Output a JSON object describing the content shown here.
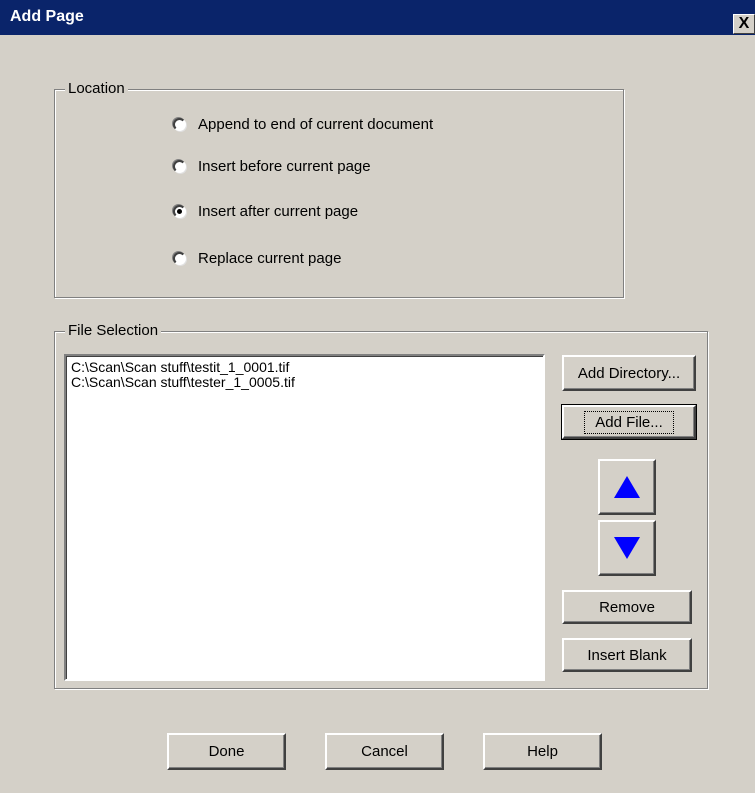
{
  "window": {
    "title": "Add Page",
    "close_symbol": "X"
  },
  "location": {
    "legend": "Location",
    "options": [
      {
        "label": "Append to end of current document",
        "checked": false
      },
      {
        "label": "Insert before current page",
        "checked": false
      },
      {
        "label": "Insert after current page",
        "checked": true
      },
      {
        "label": "Replace current page",
        "checked": false
      }
    ]
  },
  "file_selection": {
    "legend": "File Selection",
    "files": [
      "C:\\Scan\\Scan stuff\\testit_1_0001.tif",
      "C:\\Scan\\Scan stuff\\tester_1_0005.tif"
    ],
    "add_directory_label": "Add Directory...",
    "add_file_label": "Add File...",
    "move_up_icon": "blue-up-triangle",
    "move_down_icon": "blue-down-triangle",
    "remove_label": "Remove",
    "insert_blank_label": "Insert Blank"
  },
  "footer": {
    "done_label": "Done",
    "cancel_label": "Cancel",
    "help_label": "Help"
  },
  "colors": {
    "titlebar": "#0a246a",
    "dialog_bg": "#d4d0c8",
    "arrow": "#0000ff"
  }
}
